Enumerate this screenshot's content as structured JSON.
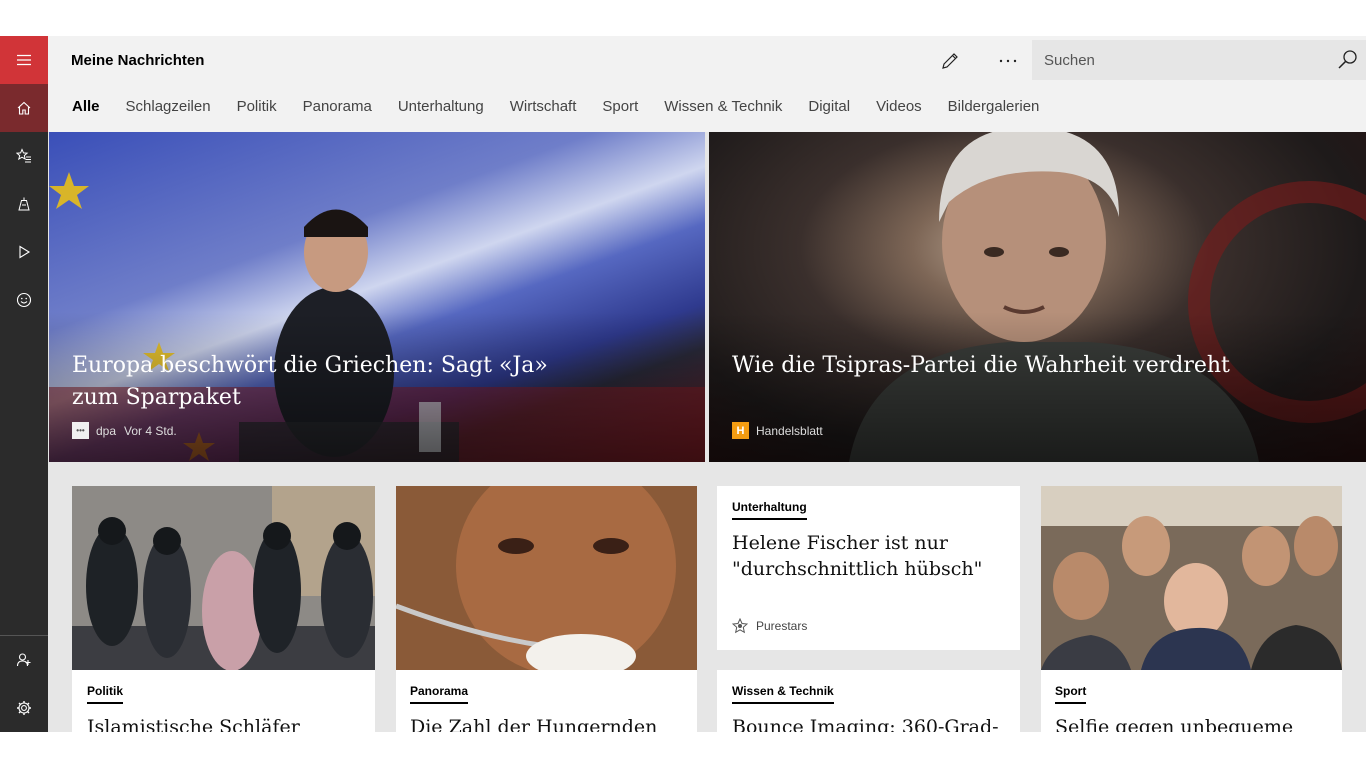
{
  "app": {
    "title": "Meine Nachrichten",
    "accent": "#d13438"
  },
  "sidebar": {
    "items": [
      {
        "icon": "hamburger-icon"
      },
      {
        "icon": "home-icon"
      },
      {
        "icon": "favorites-star-icon"
      },
      {
        "icon": "local-news-icon"
      },
      {
        "icon": "video-play-icon"
      },
      {
        "icon": "smiley-icon"
      },
      {
        "icon": "add-user-icon"
      },
      {
        "icon": "settings-gear-icon"
      }
    ]
  },
  "header": {
    "edit_icon": "pencil-icon",
    "more_icon": "more-dots-icon",
    "search": {
      "placeholder": "Suchen",
      "icon": "search-icon"
    }
  },
  "tabs": [
    "Alle",
    "Schlagzeilen",
    "Politik",
    "Panorama",
    "Unterhaltung",
    "Wirtschaft",
    "Sport",
    "Wissen & Technik",
    "Digital",
    "Videos",
    "Bildergalerien"
  ],
  "active_tab": "Alle",
  "hero": [
    {
      "headline": "Europa beschwört die Griechen: Sagt «Ja» zum Sparpaket",
      "source": "dpa",
      "time": "Vor 4 Std."
    },
    {
      "headline": "Wie die Tsipras-Partei die Wahrheit verdreht",
      "source": "Handelsblatt",
      "logo_letter": "H"
    }
  ],
  "cards": [
    {
      "category": "Politik",
      "title": "Islamistische Schläfer"
    },
    {
      "category": "Panorama",
      "title": "Die Zahl der Hungernden hat"
    },
    {
      "category": "Unterhaltung",
      "title": "Helene Fischer ist nur \"durchschnittlich hübsch\"",
      "source": "Purestars"
    },
    {
      "category": "Wissen & Technik",
      "title": "Bounce Imaging: 360-Grad-"
    },
    {
      "category": "Sport",
      "title": "Selfie gegen unbequeme"
    }
  ]
}
